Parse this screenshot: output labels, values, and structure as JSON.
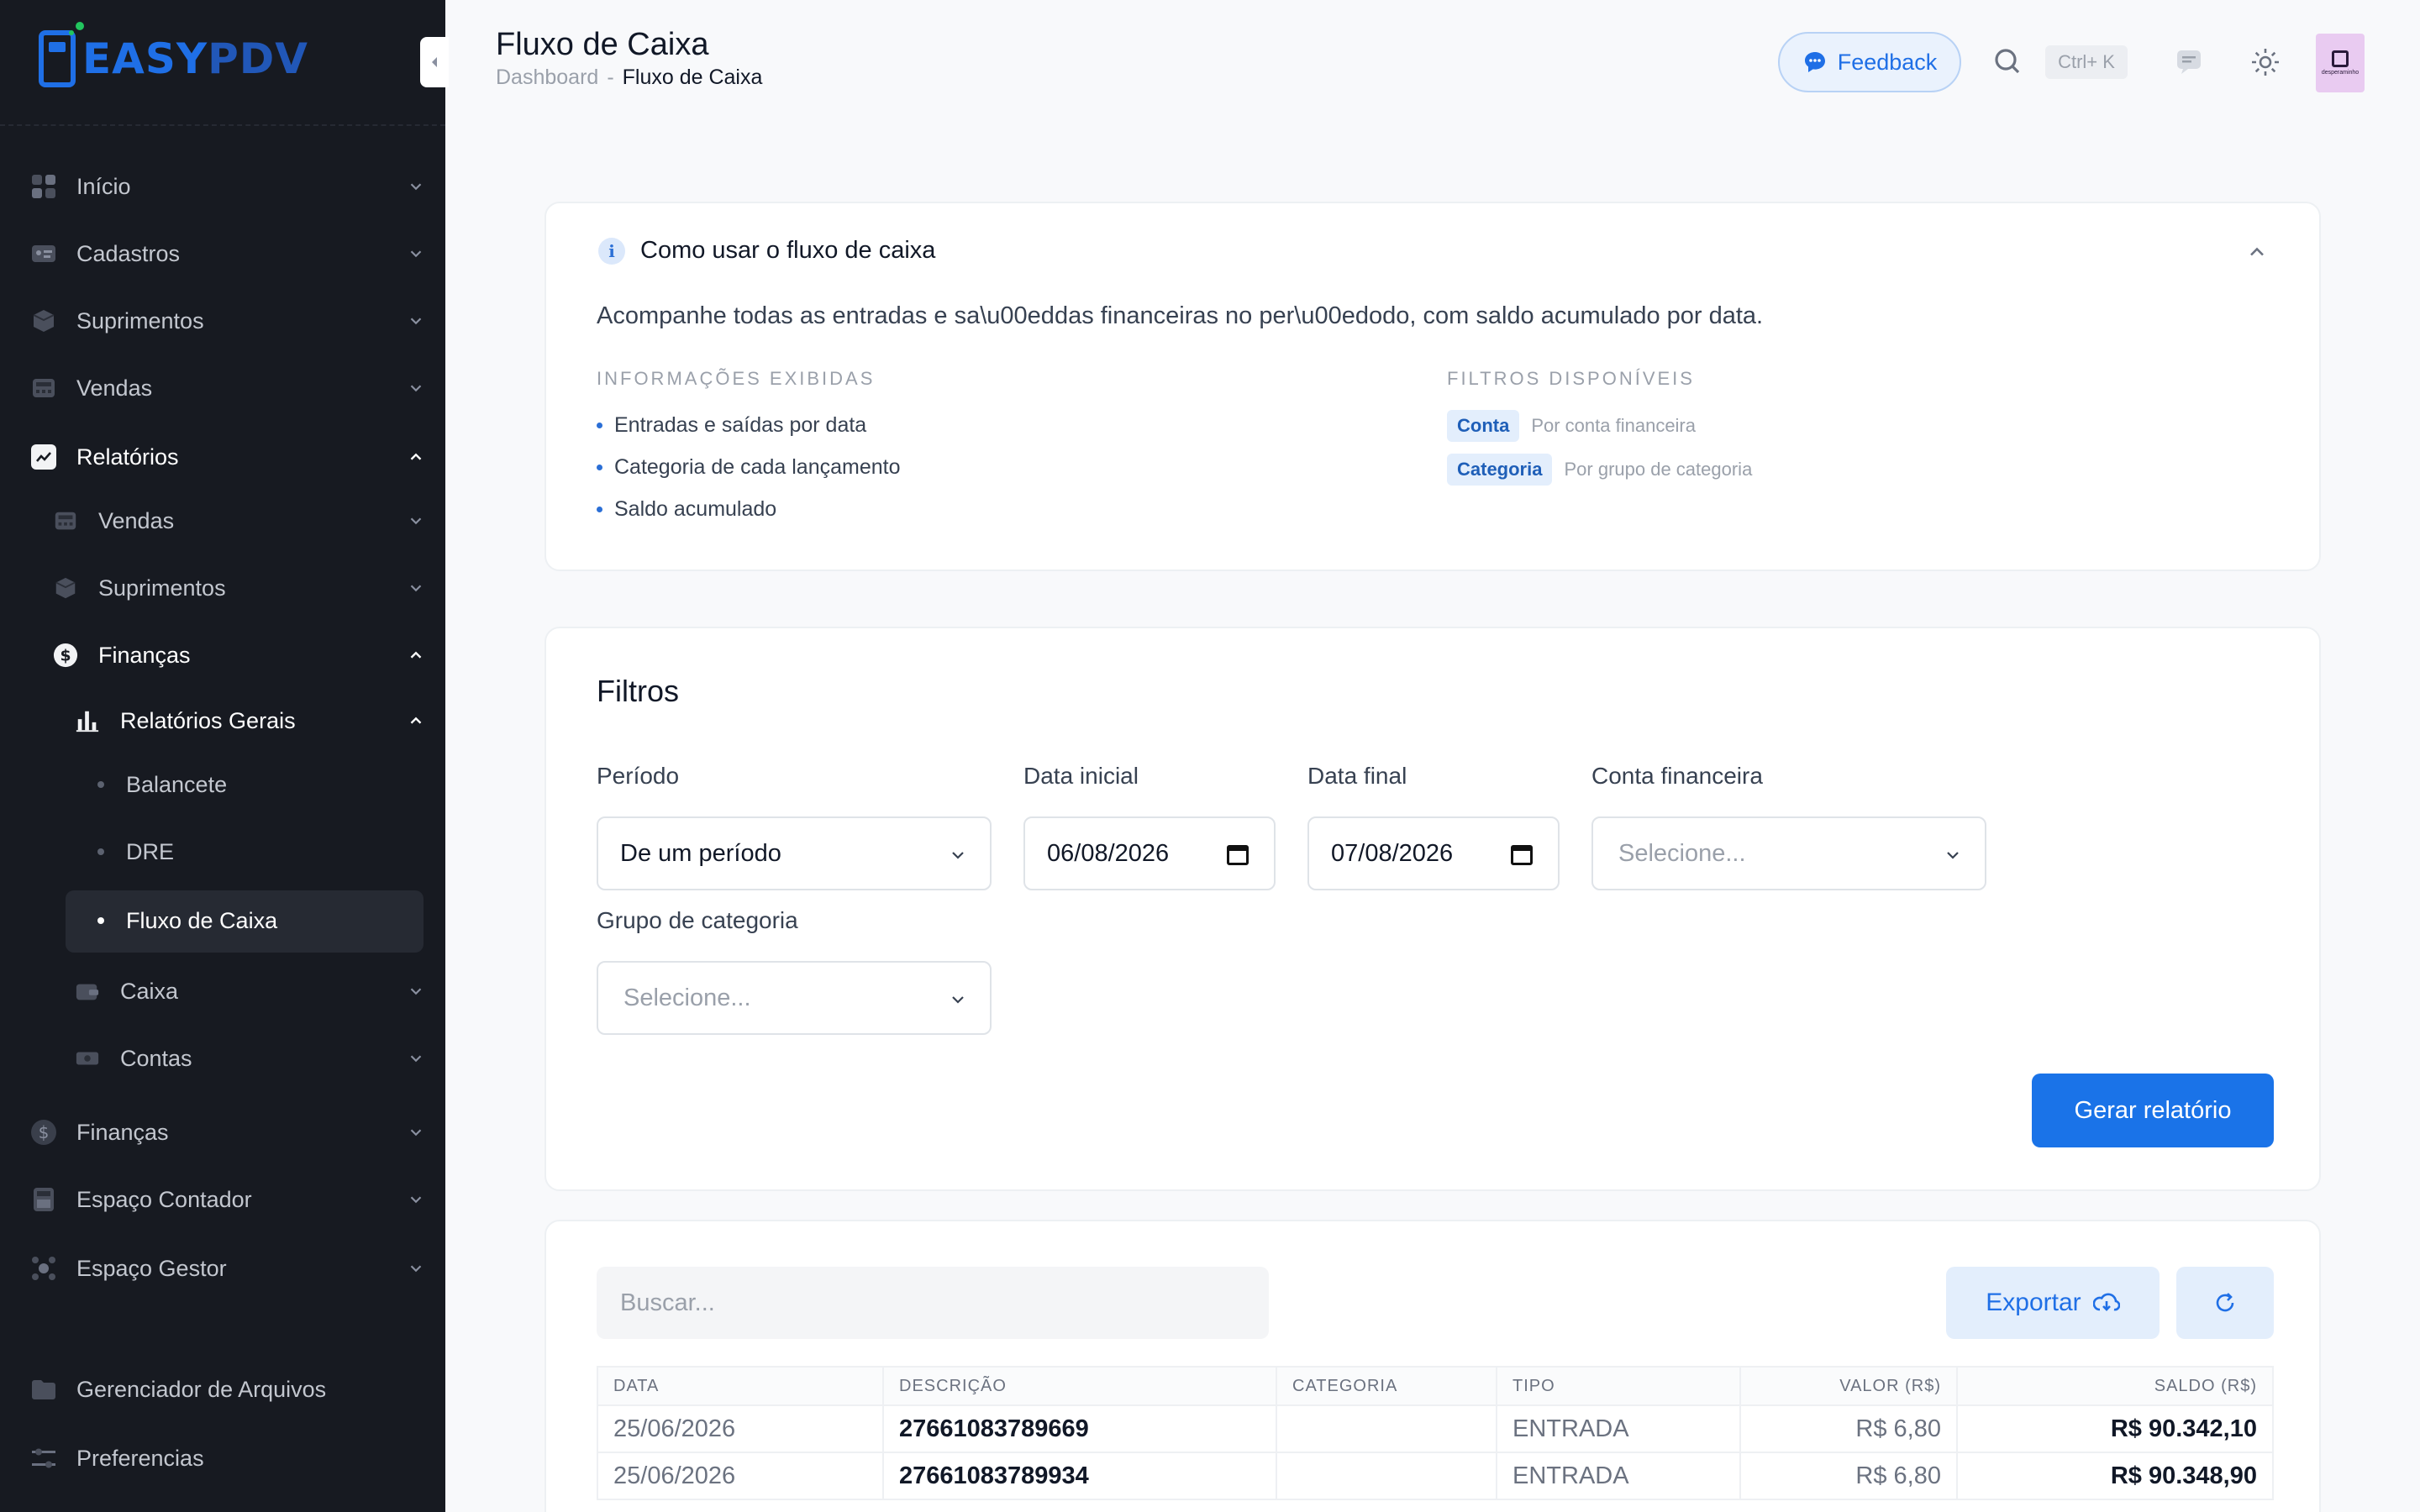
{
  "brand": {
    "easy": "EASY",
    "pdv": "PDV"
  },
  "sidebar": {
    "items": [
      {
        "label": "Início",
        "icon": "home-icon"
      },
      {
        "label": "Cadastros",
        "icon": "cadastros-icon"
      },
      {
        "label": "Suprimentos",
        "icon": "box-icon"
      },
      {
        "label": "Vendas",
        "icon": "cash-register-icon"
      },
      {
        "label": "Relatórios",
        "icon": "chart-line-icon"
      },
      {
        "label": "Vendas",
        "icon": "cash-register-icon"
      },
      {
        "label": "Suprimentos",
        "icon": "box-icon"
      },
      {
        "label": "Finanças",
        "icon": "dollar-icon"
      },
      {
        "label": "Relatórios Gerais",
        "icon": "bar-chart-icon"
      },
      {
        "label": "Balancete"
      },
      {
        "label": "DRE"
      },
      {
        "label": "Fluxo de Caixa"
      },
      {
        "label": "Caixa",
        "icon": "wallet-icon"
      },
      {
        "label": "Contas",
        "icon": "money-icon"
      },
      {
        "label": "Finanças",
        "icon": "dollar-icon"
      },
      {
        "label": "Espaço Contador",
        "icon": "calculator-icon"
      },
      {
        "label": "Espaço Gestor",
        "icon": "gestor-icon"
      },
      {
        "label": "Gerenciador de Arquivos",
        "icon": "folder-icon"
      },
      {
        "label": "Preferencias",
        "icon": "sliders-icon"
      }
    ]
  },
  "header": {
    "title": "Fluxo de Caixa",
    "breadcrumb": {
      "root": "Dashboard",
      "separator": "-",
      "current": "Fluxo de Caixa"
    },
    "feedback_label": "Feedback",
    "shortcut": "Ctrl+ K",
    "avatar_text": "desperaminho"
  },
  "info": {
    "title": "Como usar o fluxo de caixa",
    "description": "Acompanhe todas as entradas e sa\\u00eddas financeiras no per\\u00edodo, com saldo acumulado por data.",
    "shown_title": "INFORMAÇÕES EXIBIDAS",
    "shown": [
      "Entradas e saídas por data",
      "Categoria de cada lançamento",
      "Saldo acumulado"
    ],
    "filters_title": "FILTROS DISPONÍVEIS",
    "filters": [
      {
        "tag": "Conta",
        "desc": "Por conta financeira"
      },
      {
        "tag": "Categoria",
        "desc": "Por grupo de categoria"
      }
    ]
  },
  "filters": {
    "title": "Filtros",
    "periodo_label": "Período",
    "periodo_value": "De um período",
    "data_inicial_label": "Data inicial",
    "data_inicial_value": "06/08/2026",
    "data_final_label": "Data final",
    "data_final_value": "07/08/2026",
    "conta_label": "Conta financeira",
    "conta_placeholder": "Selecione...",
    "grupo_label": "Grupo de categoria",
    "grupo_placeholder": "Selecione...",
    "submit_label": "Gerar relatório"
  },
  "table": {
    "search_placeholder": "Buscar...",
    "export_label": "Exportar",
    "columns": [
      "DATA",
      "DESCRIÇÃO",
      "CATEGORIA",
      "TIPO",
      "VALOR (R$)",
      "SALDO (R$)"
    ],
    "rows": [
      {
        "data": "25/06/2026",
        "descricao": "27661083789669",
        "categoria": "",
        "tipo": "ENTRADA",
        "valor": "R$ 6,80",
        "saldo": "R$ 90.342,10"
      },
      {
        "data": "25/06/2026",
        "descricao": "27661083789934",
        "categoria": "",
        "tipo": "ENTRADA",
        "valor": "R$ 6,80",
        "saldo": "R$ 90.348,90"
      }
    ]
  },
  "colors": {
    "accent": "#1a73e8",
    "sidebar_bg": "#171a21",
    "success": "#22c55e"
  }
}
